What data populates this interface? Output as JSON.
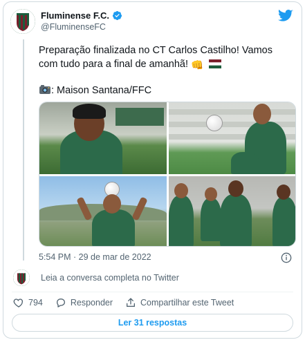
{
  "author": {
    "display_name": "Fluminense F.C.",
    "handle": "@FluminenseFC"
  },
  "tweet": {
    "line1": "Preparação finalizada no CT Carlos Castilho! Vamos",
    "line2": "com tudo para a final de amanhã!",
    "emoji_fist": "👊",
    "credit": ": Maison Santana/FFC",
    "timestamp": "5:54 PM · 29 de mar de 2022"
  },
  "thread": {
    "read_full": "Leia a conversa completa no Twitter"
  },
  "actions": {
    "likes_count": "794",
    "reply_label": "Responder",
    "share_label": "Compartilhar este Tweet"
  },
  "replies_button": "Ler 31 respostas",
  "colors": {
    "brand_blue": "#1d9bf0",
    "club_green": "#1c5c3c",
    "club_maroon": "#7a1f2b"
  }
}
